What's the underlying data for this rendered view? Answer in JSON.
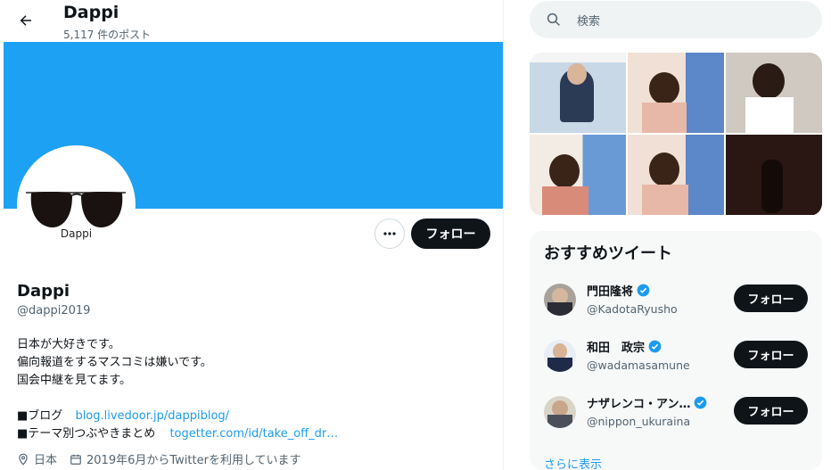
{
  "header": {
    "name": "Dappi",
    "post_count": "5,117 件のポスト"
  },
  "profile": {
    "avatar_text": "Dappi",
    "name": "Dappi",
    "handle": "@dappi2019",
    "follow_label": "フォロー",
    "bio": [
      "日本が大好きです。",
      "偏向報道をするマスコミは嫌いです。",
      "国会中継を見てます。"
    ],
    "links": [
      {
        "label": "■ブログ",
        "url": "blog.livedoor.jp/dappiblog/"
      },
      {
        "label": "■テーマ別つぶやきまとめ",
        "url": "togetter.com/id/take_off_dr…"
      }
    ],
    "location": "日本",
    "joined": "2019年6月からTwitterを利用しています"
  },
  "search": {
    "placeholder": "検索"
  },
  "recommendations": {
    "title": "おすすめツイート",
    "users": [
      {
        "name": "門田隆将",
        "handle": "@KadotaRyusho",
        "follow_label": "フォロー"
      },
      {
        "name": "和田　政宗",
        "handle": "@wadamasamune",
        "follow_label": "フォロー"
      },
      {
        "name": "ナザレンコ・アン…",
        "handle": "@nippon_ukuraina",
        "follow_label": "フォロー"
      }
    ],
    "show_more": "さらに表示"
  },
  "colors": {
    "accent": "#1d9bf0",
    "banner": "#1da1f2",
    "dark_button": "#0f1419"
  }
}
